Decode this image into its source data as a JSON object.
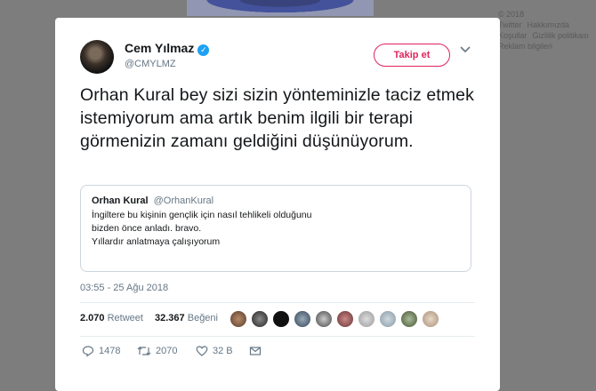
{
  "background": {
    "footer_links": [
      "© 2018 Twitter",
      "Hakkımızda",
      "Koşullar",
      "Gizlilik politikası",
      "Reklam bilgileri"
    ]
  },
  "tweet": {
    "author_name": "Cem Yılmaz",
    "author_handle": "@CMYLMZ",
    "follow_label": "Takip et",
    "text": "Orhan Kural bey sizi sizin yönteminizle taciz etmek istemiyorum ama artık benim ilgili bir terapi görmenizin zamanı geldiğini düşünüyorum.",
    "quoted": {
      "name": "Orhan Kural",
      "handle": "@OrhanKural",
      "text": "İngiltere bu kişinin gençlik için nasıl tehlikeli  olduğunu\nbizden önce anladı. bravo.\nYıllardır anlatmaya çalışıyorum"
    },
    "timestamp": "03:55 - 25 Ağu 2018",
    "retweet_count": "2.070",
    "retweet_label": "Retweet",
    "like_count": "32.367",
    "like_label": "Beğeni",
    "actions": {
      "reply_count": "1478",
      "retweet_count": "2070",
      "like_count": "32 B"
    }
  },
  "colors": {
    "accent_pink": "#e0245e",
    "verified_blue": "#1da1f2",
    "text_primary": "#14171a",
    "text_secondary": "#657786"
  },
  "icons": [
    "verified-icon",
    "chevron-down-icon",
    "reply-icon",
    "retweet-icon",
    "heart-icon",
    "message-icon"
  ]
}
